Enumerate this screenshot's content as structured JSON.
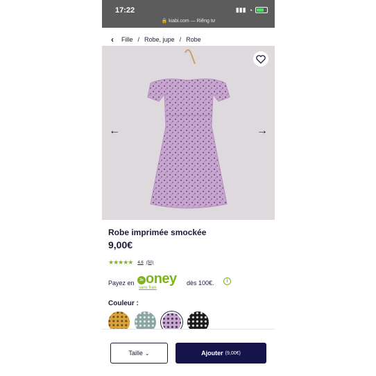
{
  "status": {
    "time": "17:22",
    "url": "kiabi.com — Riêng tư"
  },
  "breadcrumb": {
    "items": [
      "Fille",
      "Robe, jupe",
      "Robe"
    ]
  },
  "product": {
    "title": "Robe imprimée smockée",
    "price": "9,00€",
    "rating": {
      "score": "4.6",
      "count": "(50)",
      "stars": 4.6
    }
  },
  "payment": {
    "label": "Payez en",
    "badge": "3x",
    "brand": "oney",
    "sub": "sans frais",
    "threshold": "dès 100€.",
    "info": "i"
  },
  "colors": {
    "label": "Couleur :",
    "swatches": [
      "mustard-floral",
      "sage-floral",
      "lilac-floral",
      "black-floral"
    ],
    "selected_index": 2
  },
  "actions": {
    "size_label": "Taille",
    "add_label": "Ajouter",
    "add_price": "(9,00€)"
  },
  "theme": {
    "navy": "#15144a",
    "green": "#7db51d",
    "lilac": "#c9a6d2"
  }
}
